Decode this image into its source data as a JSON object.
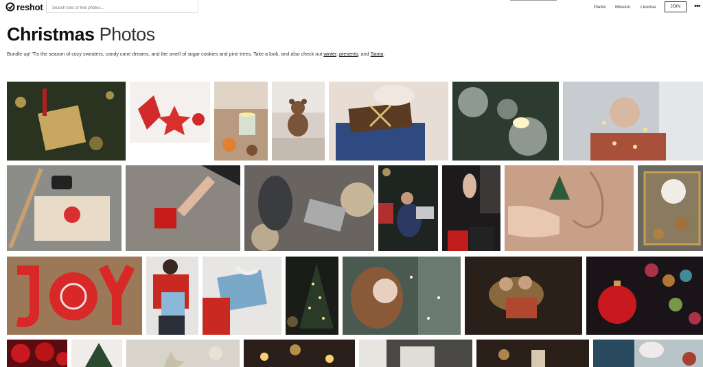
{
  "header": {
    "logo_text": "reshot",
    "search_placeholder": "Search tons of free photos...",
    "nav": [
      "Packs",
      "Mission",
      "License"
    ],
    "join_label": "JOIN",
    "more_label": "•••"
  },
  "page": {
    "title_bold": "Christmas",
    "title_light": "Photos",
    "description": "Bundle up! 'Tis the season of cozy sweaters, candy cane dreams, and the smell of sugar cookies and pine trees. Take a look, and also check out",
    "links": [
      "winter",
      "presents",
      "Santa"
    ],
    "sep_comma": ",",
    "sep_and": ", and",
    "end": "."
  },
  "colors": {
    "accent": "#111111",
    "border": "#dddddd"
  }
}
